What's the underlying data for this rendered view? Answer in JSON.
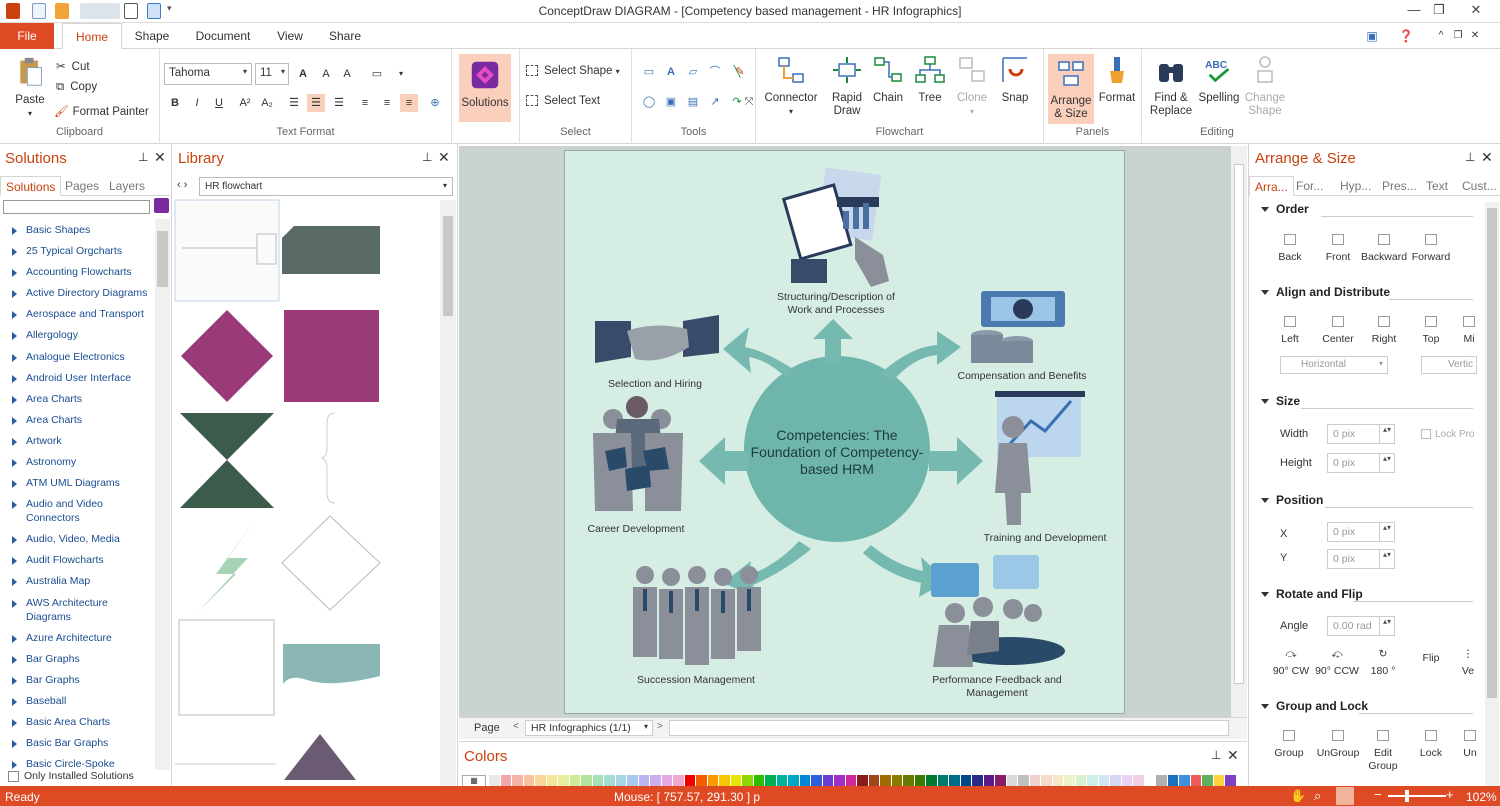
{
  "window": {
    "title": "ConceptDraw DIAGRAM - [Competency based management - HR Infographics]"
  },
  "ribbon_tabs": [
    "File",
    "Home",
    "Shape",
    "Document",
    "View",
    "Share"
  ],
  "clipboard": {
    "paste": "Paste",
    "cut": "Cut",
    "copy": "Copy",
    "format_painter": "Format Painter",
    "label": "Clipboard"
  },
  "text_format": {
    "font": "Tahoma",
    "size": "11",
    "label": "Text Format"
  },
  "solutions_btn": "Solutions",
  "select": {
    "select_shape": "Select Shape",
    "select_text": "Select Text",
    "label": "Select"
  },
  "tools_label": "Tools",
  "flowchart": {
    "connector": "Connector",
    "rapid_draw": "Rapid Draw",
    "chain": "Chain",
    "tree": "Tree",
    "clone": "Clone",
    "snap": "Snap",
    "label": "Flowchart"
  },
  "panels": {
    "arrange_size": "Arrange & Size",
    "format": "Format",
    "label": "Panels"
  },
  "editing": {
    "find_replace": "Find & Replace",
    "spelling": "Spelling",
    "change_shape": "Change Shape",
    "label": "Editing"
  },
  "solutions_panel": {
    "title": "Solutions",
    "tabs": [
      "Solutions",
      "Pages",
      "Layers"
    ],
    "items": [
      "Basic Shapes",
      "25 Typical Orgcharts",
      "Accounting Flowcharts",
      "Active Directory Diagrams",
      "Aerospace and Transport",
      "Allergology",
      "Analogue Electronics",
      "Android User Interface",
      "Area Charts",
      "Area Charts",
      "Artwork",
      "Astronomy",
      "ATM UML Diagrams",
      "Audio and Video Connectors",
      "Audio, Video, Media",
      "Audit Flowcharts",
      "Australia Map",
      "AWS Architecture Diagrams",
      "Azure Architecture",
      "Bar Graphs",
      "Bar Graphs",
      "Baseball",
      "Basic Area Charts",
      "Basic Bar Graphs",
      "Basic Circle-Spoke"
    ],
    "only_installed": "Only Installed Solutions"
  },
  "library_panel": {
    "title": "Library",
    "selected": "HR flowchart"
  },
  "canvas": {
    "center": "Competencies: The Foundation of Competency-based HRM",
    "labels": {
      "structuring": "Structuring/Description of Work and Processes",
      "selection": "Selection and Hiring",
      "compensation": "Compensation and Benefits",
      "career": "Career Development",
      "training": "Training and Development",
      "succession": "Succession Management",
      "performance": "Performance Feedback and Management"
    }
  },
  "pagebar": {
    "page": "Page",
    "tab": "HR Infographics (1/1)"
  },
  "colors_panel": {
    "title": "Colors"
  },
  "arrange_panel": {
    "title": "Arrange & Size",
    "tabs": [
      "Arra...",
      "For...",
      "Hyp...",
      "Pres...",
      "Text",
      "Cust..."
    ],
    "order": {
      "title": "Order",
      "buttons": [
        "Back",
        "Front",
        "Backward",
        "Forward"
      ]
    },
    "align": {
      "title": "Align and Distribute",
      "buttons": [
        "Left",
        "Center",
        "Right",
        "Top",
        "Mi"
      ],
      "horizontal": "Horizontal",
      "vertical": "Vertic"
    },
    "size": {
      "title": "Size",
      "width": "Width",
      "height": "Height",
      "wval": "0 pix",
      "hval": "0 pix",
      "lock": "Lock Pro"
    },
    "position": {
      "title": "Position",
      "x": "X",
      "y": "Y",
      "xval": "0 pix",
      "yval": "0 pix"
    },
    "rotate": {
      "title": "Rotate and Flip",
      "angle": "Angle",
      "aval": "0.00 rad",
      "buttons": [
        "90° CW",
        "90° CCW",
        "180 °",
        "Flip",
        "Ve"
      ]
    },
    "group": {
      "title": "Group and Lock",
      "buttons": [
        "Group",
        "UnGroup",
        "Edit Group",
        "Lock",
        "Un"
      ]
    }
  },
  "status": {
    "left": "Ready",
    "mouse": "Mouse: [ 757.57, 291.30 ] p",
    "zoom": "102%"
  },
  "palette": [
    "#e8e8e8",
    "#f4a7a7",
    "#f7b2a6",
    "#f8c29f",
    "#f7d79a",
    "#f4e79a",
    "#e7ef9a",
    "#cdeb9b",
    "#b1e39d",
    "#a5e0b4",
    "#a2dcd0",
    "#a6d6e6",
    "#a9c7ef",
    "#b6b5ef",
    "#ccaeee",
    "#e6a9e6",
    "#f0a8cf",
    "#ee0000",
    "#f55d00",
    "#f89a00",
    "#f6c700",
    "#e6e600",
    "#8fd600",
    "#2ebd00",
    "#00b050",
    "#00b39a",
    "#00a8c6",
    "#0086d6",
    "#2c5fd8",
    "#6a3ed4",
    "#a02ec9",
    "#d1279a",
    "#8b1a1a",
    "#a0451a",
    "#a06b00",
    "#8a7a00",
    "#6a7a00",
    "#3a7a00",
    "#007a30",
    "#007a6a",
    "#006a8a",
    "#004a8a",
    "#2a2a8a",
    "#5a1a8a",
    "#8a1a6a",
    "#d9d9d9",
    "#c0c0c0",
    "#f2d0d0",
    "#f5dcc8",
    "#f7e7c8",
    "#eef2c8",
    "#d8efd0",
    "#cfeee6",
    "#d0e6f2",
    "#d6d6f2",
    "#ead0f2",
    "#f2d0e6",
    "#ffffff",
    "#b0b0b0",
    "#1f6fbf",
    "#3f8fdf",
    "#f05a5a",
    "#60b060",
    "#ffd040",
    "#8040c0",
    "#20a0a0",
    "#c06020",
    "#7f7f7f",
    "#404040",
    "#000000",
    "#1a3a6a",
    "#6a3a1a",
    "#3a6a1a",
    "#6a1a3a",
    "#1a6a6a",
    "#9a9a9a",
    "#b46c3c"
  ]
}
